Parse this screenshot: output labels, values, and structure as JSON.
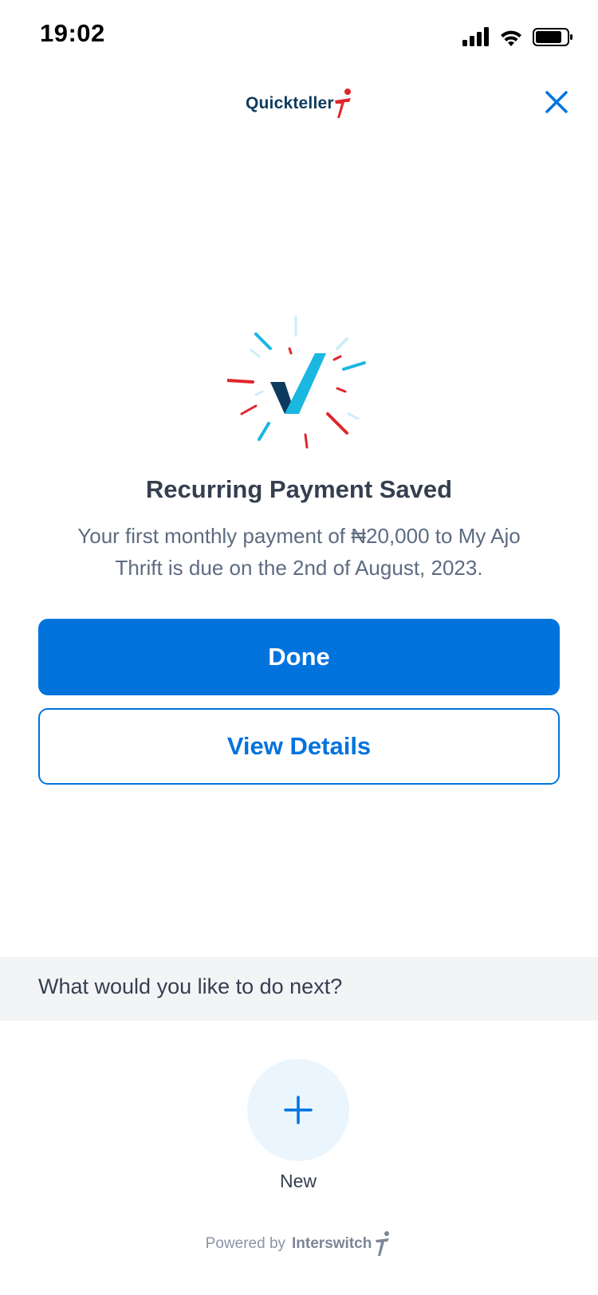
{
  "status_bar": {
    "time": "19:02",
    "icons": [
      "signal-icon",
      "wifi-icon",
      "battery-icon"
    ]
  },
  "header": {
    "logo_text": "Quickteller",
    "close_icon": "close-icon"
  },
  "result": {
    "title": "Recurring Payment Saved",
    "message": "Your first monthly payment of ₦20,000 to My Ajo Thrift is due on the 2nd of August, 2023."
  },
  "actions": {
    "done_label": "Done",
    "view_details_label": "View Details"
  },
  "next": {
    "prompt": "What would you like to do next?",
    "new_label": "New",
    "new_icon": "plus-icon"
  },
  "footer": {
    "powered_by": "Powered by",
    "brand": "Interswitch"
  },
  "colors": {
    "primary": "#0073dd",
    "brand_navy": "#0d3b5e",
    "brand_red": "#e0262c",
    "accent_cyan": "#1ab7e0",
    "section_bg": "#f3f4f6",
    "circle_bg": "#eaf5fd"
  }
}
